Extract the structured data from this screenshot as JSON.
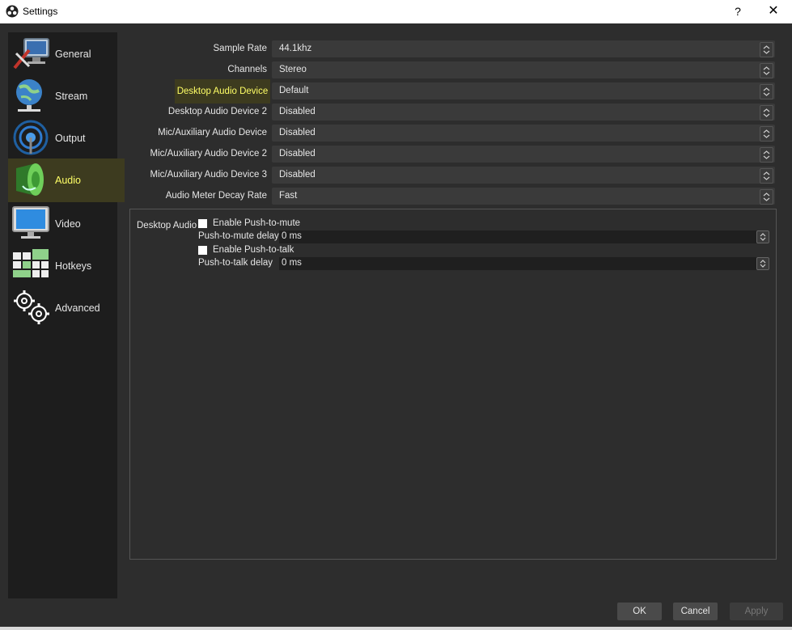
{
  "window": {
    "title": "Settings",
    "help_icon": "?",
    "close_icon": "✕"
  },
  "sidebar": {
    "items": [
      {
        "label": "General",
        "icon": "general-icon"
      },
      {
        "label": "Stream",
        "icon": "stream-icon"
      },
      {
        "label": "Output",
        "icon": "output-icon"
      },
      {
        "label": "Audio",
        "icon": "audio-icon",
        "selected": true
      },
      {
        "label": "Video",
        "icon": "video-icon"
      },
      {
        "label": "Hotkeys",
        "icon": "hotkeys-icon"
      },
      {
        "label": "Advanced",
        "icon": "advanced-icon"
      }
    ]
  },
  "audio": {
    "fields": [
      {
        "label": "Sample Rate",
        "value": "44.1khz"
      },
      {
        "label": "Channels",
        "value": "Stereo"
      },
      {
        "label": "Desktop Audio Device",
        "value": "Default",
        "highlighted": true
      },
      {
        "label": "Desktop Audio Device 2",
        "value": "Disabled"
      },
      {
        "label": "Mic/Auxiliary Audio Device",
        "value": "Disabled"
      },
      {
        "label": "Mic/Auxiliary Audio Device 2",
        "value": "Disabled"
      },
      {
        "label": "Mic/Auxiliary Audio Device 3",
        "value": "Disabled"
      },
      {
        "label": "Audio Meter Decay Rate",
        "value": "Fast"
      }
    ],
    "hotkey_group": {
      "label": "Desktop Audio",
      "push_to_mute_label": "Enable Push-to-mute",
      "push_to_mute_delay_label": "Push-to-mute delay",
      "push_to_mute_delay_value": "0 ms",
      "push_to_talk_label": "Enable Push-to-talk",
      "push_to_talk_delay_label": "Push-to-talk delay",
      "push_to_talk_delay_value": "0 ms"
    }
  },
  "buttons": {
    "ok": "OK",
    "cancel": "Cancel",
    "apply": "Apply"
  },
  "colors": {
    "highlight_bg": "#3d3b1f",
    "highlight_text": "#ffff66",
    "background": "#2d2d2d",
    "sidebar": "#1d1d1d"
  }
}
